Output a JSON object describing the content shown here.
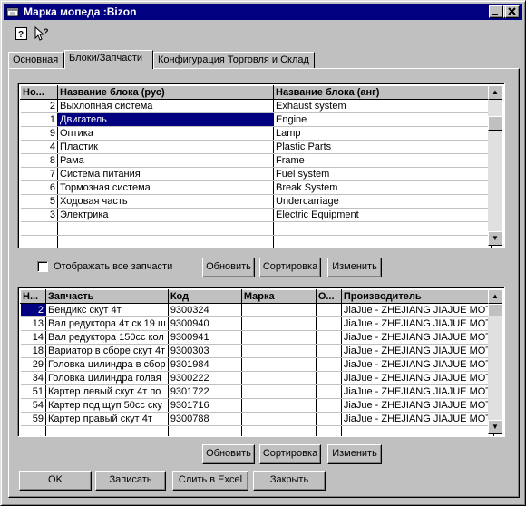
{
  "window": {
    "title": "Марка мопеда :Bizon",
    "controls": [
      "minimize-icon",
      "maximize-icon",
      "close-icon"
    ]
  },
  "toolbar": {
    "help_icon": "?",
    "whatsthis_icon": "?"
  },
  "tabs": [
    {
      "label": "Основная",
      "active": false
    },
    {
      "label": "Блоки/Запчасти",
      "active": true
    },
    {
      "label": "Конфигурация Торговля и Склад",
      "active": false
    }
  ],
  "blocks": {
    "columns": [
      "Но...",
      "Название блока (рус)",
      "Название блока (анг)"
    ],
    "rows": [
      {
        "num": "2",
        "rus": "Выхлопная система",
        "eng": "Exhaust system"
      },
      {
        "num": "1",
        "rus": "Двигатель",
        "eng": "Engine",
        "selected": true
      },
      {
        "num": "9",
        "rus": "Оптика",
        "eng": "Lamp"
      },
      {
        "num": "4",
        "rus": "Пластик",
        "eng": "Plastic Parts"
      },
      {
        "num": "8",
        "rus": "Рама",
        "eng": "Frame"
      },
      {
        "num": "7",
        "rus": "Система питания",
        "eng": "Fuel system"
      },
      {
        "num": "6",
        "rus": "Тормозная система",
        "eng": "Break System"
      },
      {
        "num": "5",
        "rus": "Ходовая часть",
        "eng": "Undercarriage"
      },
      {
        "num": "3",
        "rus": "Электрика",
        "eng": "Electric Equipment"
      },
      {
        "num": "",
        "rus": "",
        "eng": ""
      },
      {
        "num": "",
        "rus": "",
        "eng": ""
      }
    ]
  },
  "show_all_parts": {
    "label": "Отображать все запчасти",
    "checked": false
  },
  "block_buttons": {
    "refresh": "Обновить",
    "sort": "Сортировка",
    "edit": "Изменить"
  },
  "parts": {
    "columns": [
      "Н...",
      "Запчасть",
      "Код",
      "Марка",
      "О...",
      "Производитель"
    ],
    "rows": [
      {
        "num": "2",
        "name": "Бендикс скут 4т",
        "code": "9300324",
        "brand": "",
        "o": "",
        "maker": "JiaJue - ZHEJIANG JIAJUE MOT",
        "selected": true
      },
      {
        "num": "13",
        "name": "Вал редуктора 4т ск 19 ш",
        "code": "9300940",
        "brand": "",
        "o": "",
        "maker": "JiaJue - ZHEJIANG JIAJUE MOT"
      },
      {
        "num": "14",
        "name": "Вал редуктора 150сс кол",
        "code": "9300941",
        "brand": "",
        "o": "",
        "maker": "JiaJue - ZHEJIANG JIAJUE MOT"
      },
      {
        "num": "18",
        "name": "Вариатор в сборе скут 4т",
        "code": "9300303",
        "brand": "",
        "o": "",
        "maker": "JiaJue - ZHEJIANG JIAJUE MOT"
      },
      {
        "num": "29",
        "name": "Головка цилиндра в сбор",
        "code": "9301984",
        "brand": "",
        "o": "",
        "maker": "JiaJue - ZHEJIANG JIAJUE MOT"
      },
      {
        "num": "34",
        "name": "Головка цилиндра голая",
        "code": "9300222",
        "brand": "",
        "o": "",
        "maker": "JiaJue - ZHEJIANG JIAJUE MOT"
      },
      {
        "num": "51",
        "name": "Картер левый скут 4т по",
        "code": "9301722",
        "brand": "",
        "o": "",
        "maker": "JiaJue - ZHEJIANG JIAJUE MOT"
      },
      {
        "num": "54",
        "name": "Картер под щуп 50сс ску",
        "code": "9301716",
        "brand": "",
        "o": "",
        "maker": "JiaJue - ZHEJIANG JIAJUE MOT"
      },
      {
        "num": "59",
        "name": "Картер правый скут 4т",
        "code": "9300788",
        "brand": "",
        "o": "",
        "maker": "JiaJue - ZHEJIANG JIAJUE MOT"
      },
      {
        "num": "",
        "name": "",
        "code": "",
        "brand": "",
        "o": "",
        "maker": ""
      }
    ]
  },
  "part_buttons": {
    "refresh": "Обновить",
    "sort": "Сортировка",
    "edit": "Изменить"
  },
  "footer_buttons": {
    "ok": "OK",
    "save": "Записать",
    "excel": "Слить в Excel",
    "close": "Закрыть"
  }
}
